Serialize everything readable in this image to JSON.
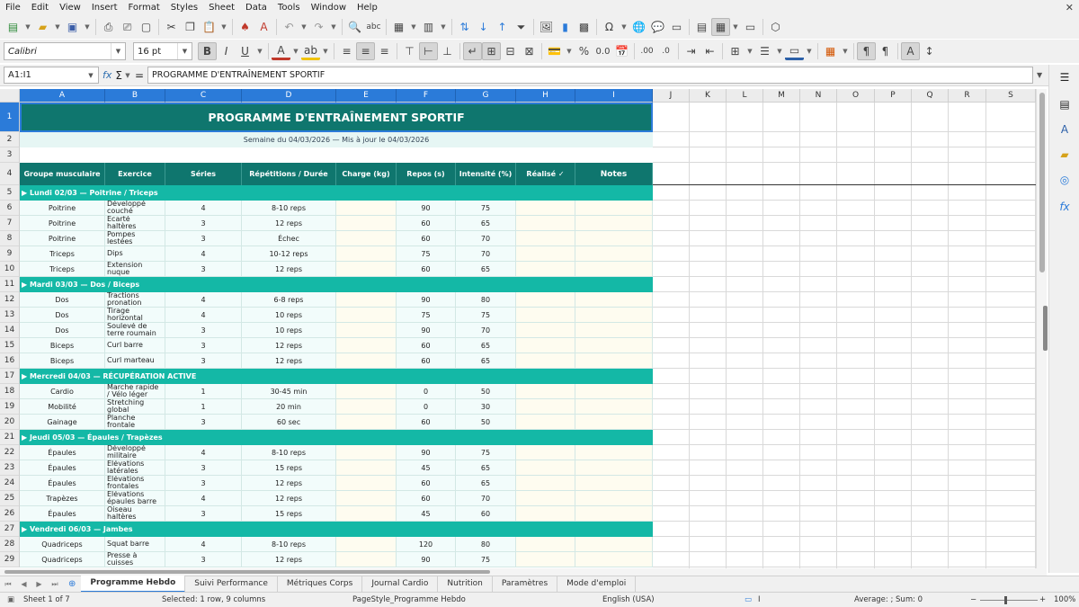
{
  "menu": [
    "File",
    "Edit",
    "View",
    "Insert",
    "Format",
    "Styles",
    "Sheet",
    "Data",
    "Tools",
    "Window",
    "Help"
  ],
  "toolbar": {
    "font_name": "Calibri",
    "font_size": "16 pt"
  },
  "formula_bar": {
    "cell_ref": "A1:I1",
    "content": "PROGRAMME D'ENTRAÎNEMENT SPORTIF",
    "fx": "fx",
    "sum": "Σ",
    "equals": "="
  },
  "columns": [
    "A",
    "B",
    "C",
    "D",
    "E",
    "F",
    "G",
    "H",
    "I",
    "J",
    "K",
    "L",
    "M",
    "N",
    "O",
    "P",
    "Q",
    "R",
    "S"
  ],
  "rows": [
    "1",
    "2",
    "3",
    "4",
    "5",
    "6",
    "7",
    "8",
    "9",
    "10",
    "11",
    "12",
    "13",
    "14",
    "15",
    "16",
    "17",
    "18",
    "19",
    "20",
    "21",
    "22",
    "23",
    "24",
    "25",
    "26",
    "27",
    "28",
    "29"
  ],
  "sheet": {
    "title": "PROGRAMME D'ENTRAÎNEMENT SPORTIF",
    "subtitle": "Semaine du 04/03/2026 — Mis à jour le 04/03/2026",
    "headers": [
      "Groupe musculaire",
      "Exercice",
      "Séries",
      "Répétitions / Durée",
      "Charge (kg)",
      "Repos (s)",
      "Intensité (%)",
      "Réalisé ✓",
      "Notes"
    ],
    "days": [
      {
        "label": "▶  Lundi 02/03 — Poitrine / Triceps",
        "rows": [
          [
            "Poitrine",
            "Développé couché",
            "4",
            "8-10 reps",
            "",
            "90",
            "75"
          ],
          [
            "Poitrine",
            "Écarté haltères",
            "3",
            "12 reps",
            "",
            "60",
            "65"
          ],
          [
            "Poitrine",
            "Pompes lestées",
            "3",
            "Échec",
            "",
            "60",
            "70"
          ],
          [
            "Triceps",
            "Dips",
            "4",
            "10-12 reps",
            "",
            "75",
            "70"
          ],
          [
            "Triceps",
            "Extension nuque",
            "3",
            "12 reps",
            "",
            "60",
            "65"
          ]
        ]
      },
      {
        "label": "▶  Mardi 03/03 — Dos / Biceps",
        "rows": [
          [
            "Dos",
            "Tractions pronation",
            "4",
            "6-8 reps",
            "",
            "90",
            "80"
          ],
          [
            "Dos",
            "Tirage horizontal",
            "4",
            "10 reps",
            "",
            "75",
            "75"
          ],
          [
            "Dos",
            "Soulevé de terre roumain",
            "3",
            "10 reps",
            "",
            "90",
            "70"
          ],
          [
            "Biceps",
            "Curl barre",
            "3",
            "12 reps",
            "",
            "60",
            "65"
          ],
          [
            "Biceps",
            "Curl marteau",
            "3",
            "12 reps",
            "",
            "60",
            "65"
          ]
        ]
      },
      {
        "label": "▶  Mercredi 04/03 — RÉCUPÉRATION ACTIVE",
        "rows": [
          [
            "Cardio",
            "Marche rapide / Vélo léger",
            "1",
            "30-45 min",
            "",
            "0",
            "50"
          ],
          [
            "Mobilité",
            "Stretching global",
            "1",
            "20 min",
            "",
            "0",
            "30"
          ],
          [
            "Gainage",
            "Planche frontale",
            "3",
            "60 sec",
            "",
            "60",
            "50"
          ]
        ]
      },
      {
        "label": "▶  Jeudi 05/03 — Épaules / Trapèzes",
        "rows": [
          [
            "Épaules",
            "Développé militaire",
            "4",
            "8-10 reps",
            "",
            "90",
            "75"
          ],
          [
            "Épaules",
            "Élévations latérales",
            "3",
            "15 reps",
            "",
            "45",
            "65"
          ],
          [
            "Épaules",
            "Élévations frontales",
            "3",
            "12 reps",
            "",
            "60",
            "65"
          ],
          [
            "Trapèzes",
            "Élévations épaules barre",
            "4",
            "12 reps",
            "",
            "60",
            "70"
          ],
          [
            "Épaules",
            "Oiseau haltères",
            "3",
            "15 reps",
            "",
            "45",
            "60"
          ]
        ]
      },
      {
        "label": "▶  Vendredi 06/03 — Jambes",
        "rows": [
          [
            "Quadriceps",
            "Squat barre",
            "4",
            "8-10 reps",
            "",
            "120",
            "80"
          ],
          [
            "Quadriceps",
            "Presse à cuisses",
            "3",
            "12 reps",
            "",
            "90",
            "75"
          ]
        ]
      }
    ]
  },
  "tabs": [
    "Programme Hebdo",
    "Suivi Performance",
    "Métriques Corps",
    "Journal Cardio",
    "Nutrition",
    "Paramètres",
    "Mode d'emploi"
  ],
  "status": {
    "sheet": "Sheet 1 of 7",
    "selection": "Selected: 1 row, 9 columns",
    "pagestyle": "PageStyle_Programme Hebdo",
    "language": "English (USA)",
    "summary": "Average: ; Sum: 0",
    "zoom": "100%"
  },
  "colors": {
    "title_bg": "#0f766e",
    "day_bg": "#14b8a6",
    "header_bg": "#0f766e",
    "row_bg": "#f2fcfb",
    "input_bg": "#fefcf0",
    "selection": "#2b7bd9"
  }
}
